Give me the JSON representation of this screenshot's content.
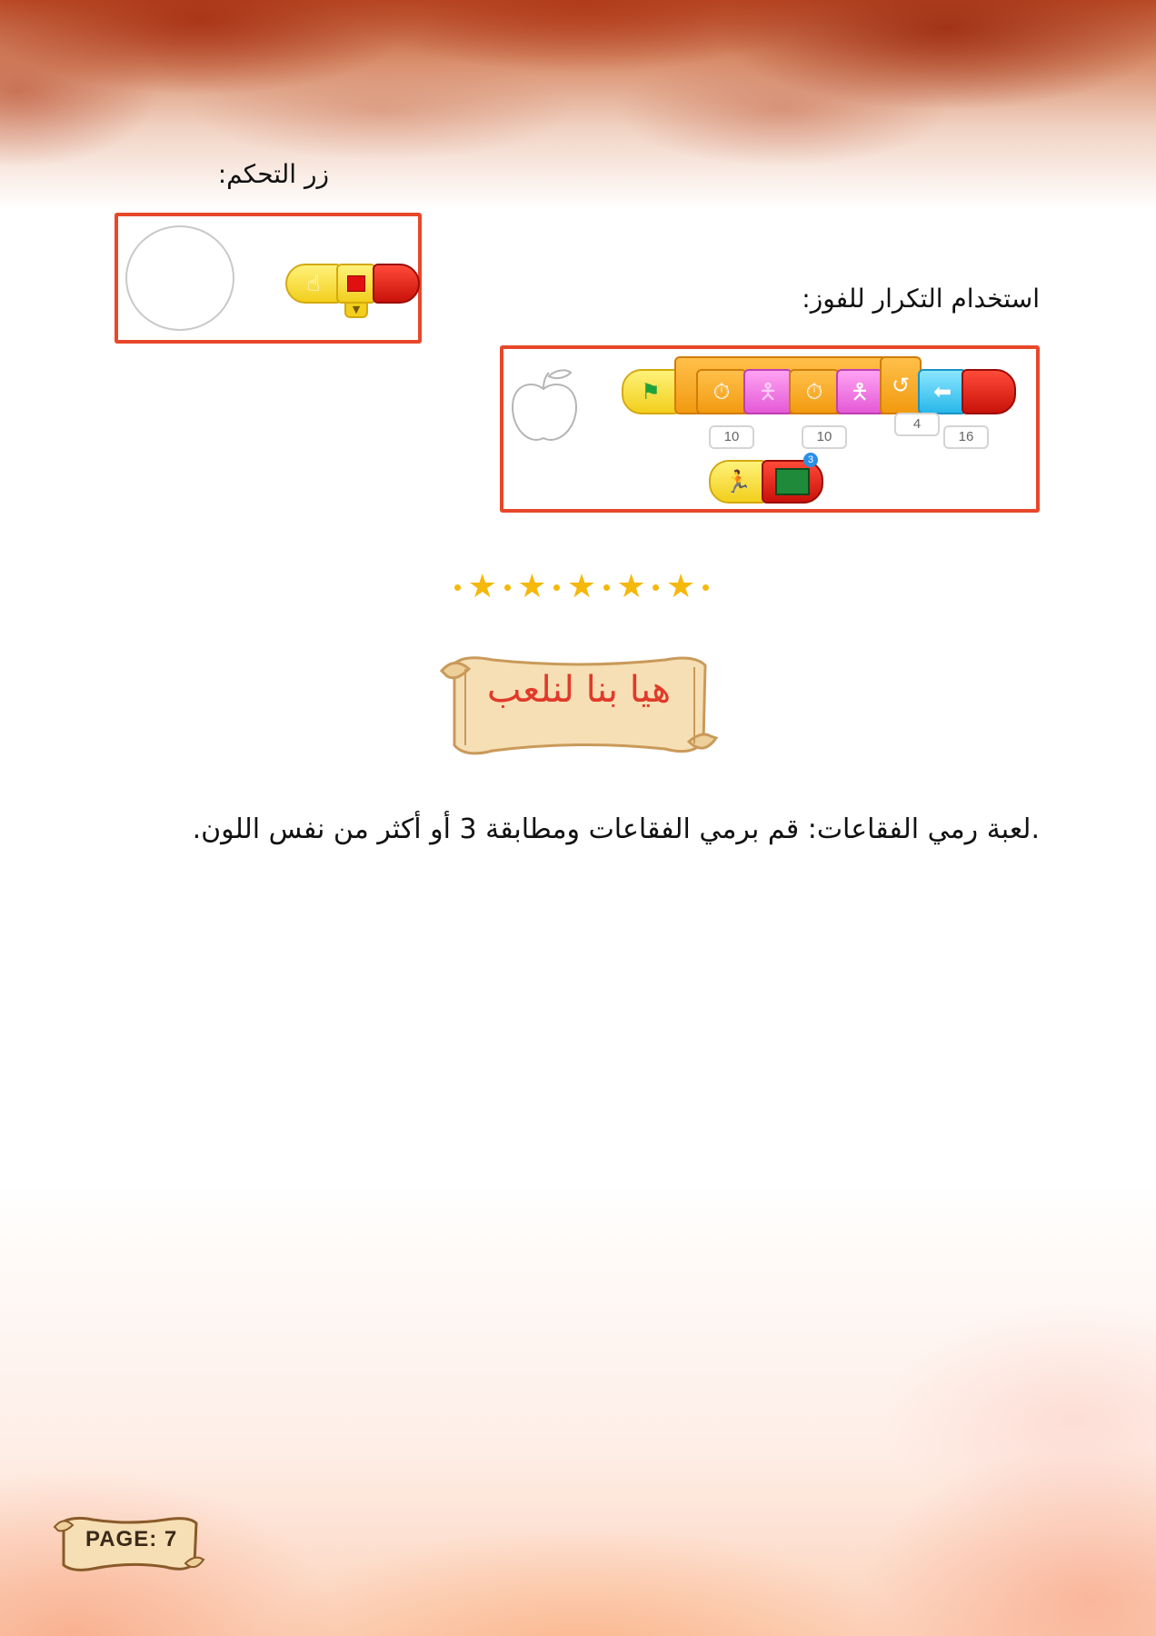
{
  "labels": {
    "control_button": "زر التحكم:",
    "repeat_to_win": "استخدام التكرار للفوز:"
  },
  "control_panel": {
    "icons": [
      "touch-hand-icon",
      "red-square-icon",
      "dropdown-arrow-icon",
      "end-block"
    ]
  },
  "repeat_panel": {
    "icons": [
      "green-flag-icon",
      "stopwatch-icon",
      "person-icon",
      "stopwatch-icon",
      "person-icon",
      "repeat-arrow-icon",
      "move-left-icon",
      "end-block",
      "running-people-icon",
      "scene-thumbnail-icon"
    ],
    "wait_1": "10",
    "wait_2": "10",
    "repeat_count": "4",
    "move_steps": "16",
    "scene_badge": "3"
  },
  "scroll_title": "هيا بنا لنلعب",
  "paragraph": ".لعبة رمي الفقاعات: قم برمي الفقاعات ومطابقة 3 أو أكثر من نفس اللون.",
  "footer": {
    "page_label": "PAGE: 7"
  },
  "colors": {
    "panel_border": "#e8472a",
    "title_red": "#e03a2a",
    "star_gold": "#f5b80c"
  }
}
